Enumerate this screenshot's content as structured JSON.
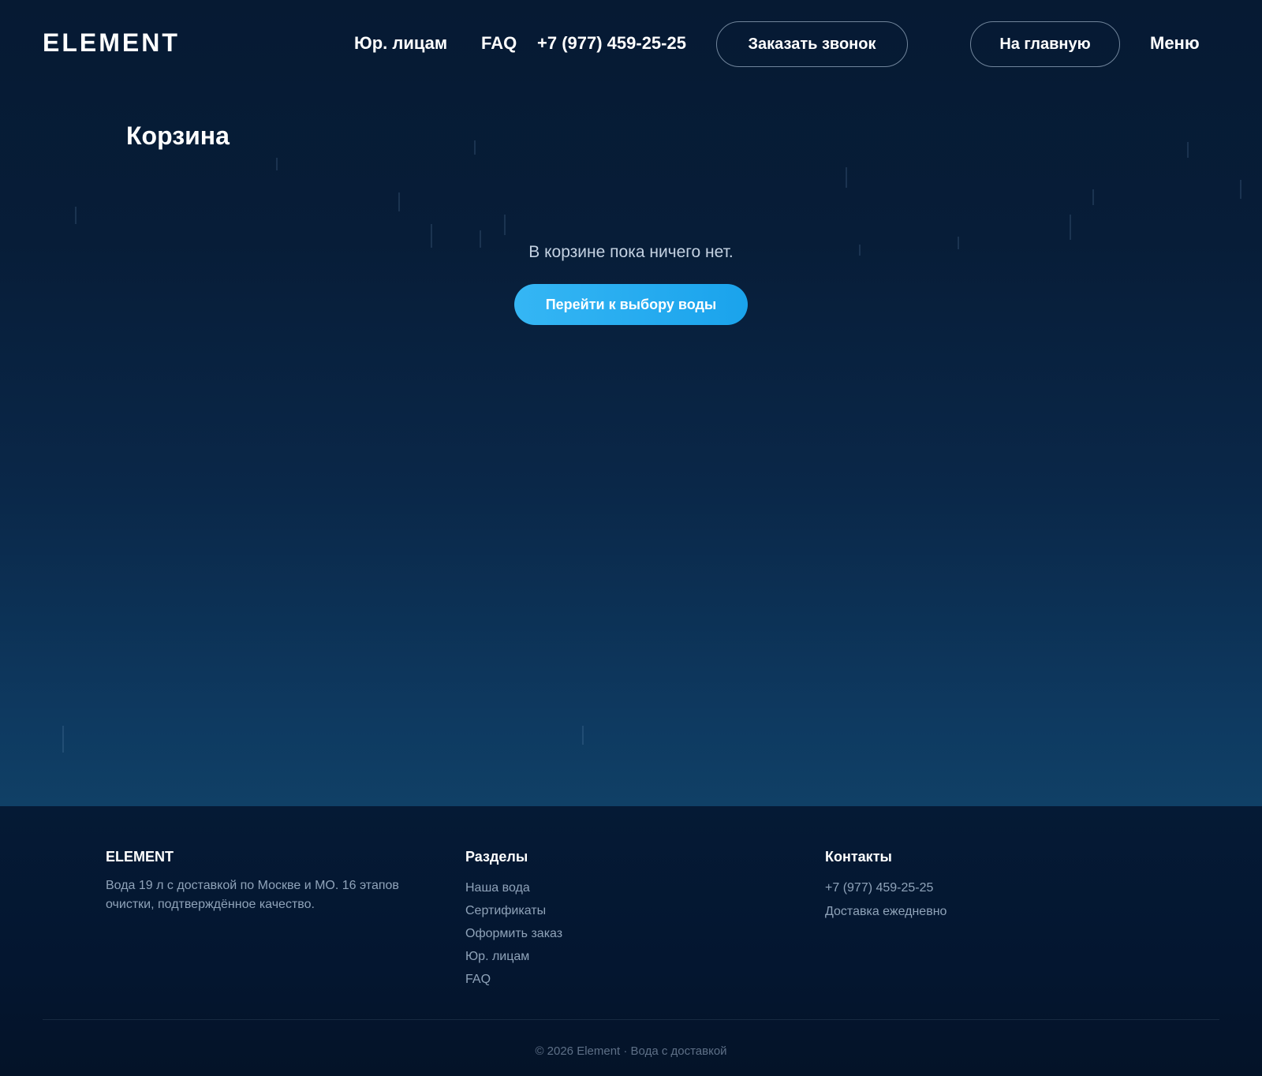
{
  "header": {
    "logo": "ELEMENT",
    "nav": {
      "legal": "Юр. лицам",
      "faq": "FAQ",
      "phone": "+7 (977) 459-25-25",
      "callback_button": "Заказать звонок",
      "home_button": "На главную",
      "menu": "Меню"
    }
  },
  "main": {
    "title": "Корзина",
    "empty_message": "В корзине пока ничего нет.",
    "cta_button": "Перейти к выбору воды"
  },
  "footer": {
    "brand": {
      "title": "ELEMENT",
      "description": "Вода 19 л с доставкой по Москве и МО. 16 этапов очистки, подтверждённое качество."
    },
    "sections": {
      "title": "Разделы",
      "links": [
        "Наша вода",
        "Сертификаты",
        "Оформить заказ",
        "Юр. лицам",
        "FAQ"
      ]
    },
    "contacts": {
      "title": "Контакты",
      "phone": "+7 (977) 459-25-25",
      "delivery": "Доставка ежедневно"
    },
    "copyright": "© 2026 Element · Вода с доставкой"
  },
  "colors": {
    "accent": "#1aa3ec",
    "background_top": "#061a33",
    "background_bottom": "#104066",
    "footer_background": "#041630",
    "muted_text": "#8fa3b9"
  }
}
